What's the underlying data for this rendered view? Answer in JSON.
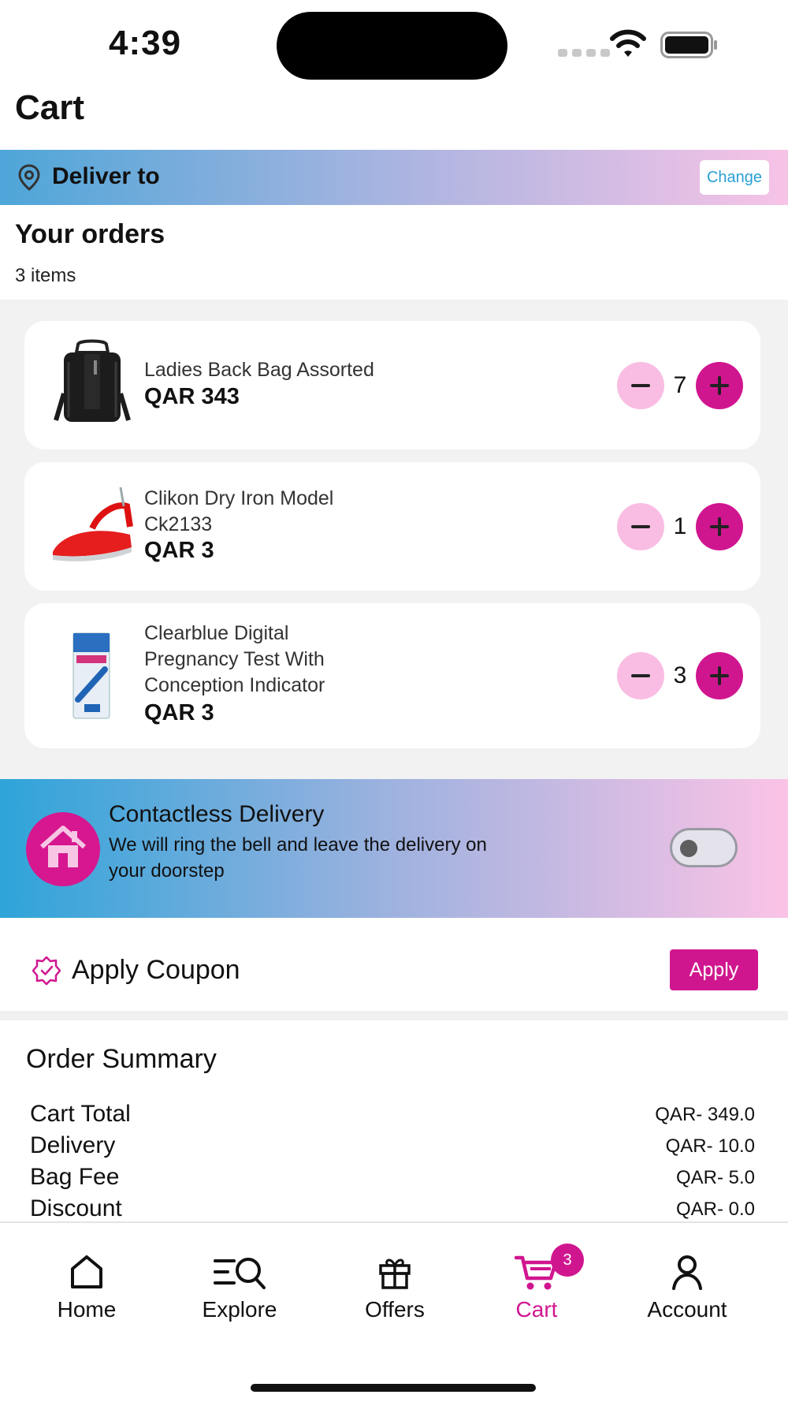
{
  "status_bar": {
    "time": "4:39"
  },
  "header": {
    "title": "Cart"
  },
  "deliver": {
    "label": "Deliver to",
    "change_label": "Change"
  },
  "orders": {
    "title": "Your orders",
    "count_label": "3 items",
    "items": [
      {
        "name": "Ladies Back Bag Assorted",
        "price": "QAR 343",
        "quantity": "7",
        "image": "backpack"
      },
      {
        "name": "Clikon Dry Iron Model Ck2133",
        "price": "QAR 3",
        "quantity": "1",
        "image": "iron"
      },
      {
        "name": "Clearblue Digital Pregnancy Test With Conception Indicator",
        "price": "QAR 3",
        "quantity": "3",
        "image": "pregnancy-test"
      }
    ]
  },
  "contactless": {
    "title": "Contactless Delivery",
    "description": "We will ring the bell and leave the delivery on\n your doorstep",
    "enabled": false
  },
  "coupon": {
    "label": "Apply Coupon",
    "apply_label": "Apply"
  },
  "summary": {
    "title": "Order Summary",
    "rows": [
      {
        "label": "Cart Total",
        "value": "QAR- 349.0"
      },
      {
        "label": "Delivery",
        "value": "QAR- 10.0"
      },
      {
        "label": "Bag Fee",
        "value": "QAR- 5.0"
      },
      {
        "label": "Discount",
        "value": "QAR- 0.0"
      }
    ]
  },
  "nav": {
    "items": [
      {
        "label": "Home",
        "icon": "home-icon"
      },
      {
        "label": "Explore",
        "icon": "explore-icon"
      },
      {
        "label": "Offers",
        "icon": "gift-icon"
      },
      {
        "label": "Cart",
        "icon": "cart-icon",
        "badge": "3",
        "active": true
      },
      {
        "label": "Account",
        "icon": "account-icon"
      }
    ]
  },
  "colors": {
    "accent": "#d0168f",
    "accent_light": "#f9bde3",
    "link": "#2a9fd6"
  }
}
